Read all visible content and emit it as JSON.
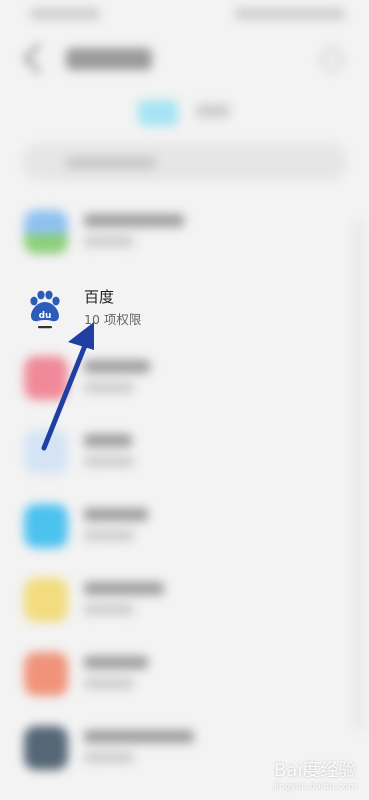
{
  "app": {
    "name": "百度",
    "permissions": "10 项权限"
  },
  "watermark": {
    "brand": "Bai度经验",
    "url": "jingyan.baidu.com"
  },
  "colors": {
    "arrow": "#1f3fa3",
    "baidu_blue": "#2b5db8",
    "background": "#f3f3f3"
  }
}
